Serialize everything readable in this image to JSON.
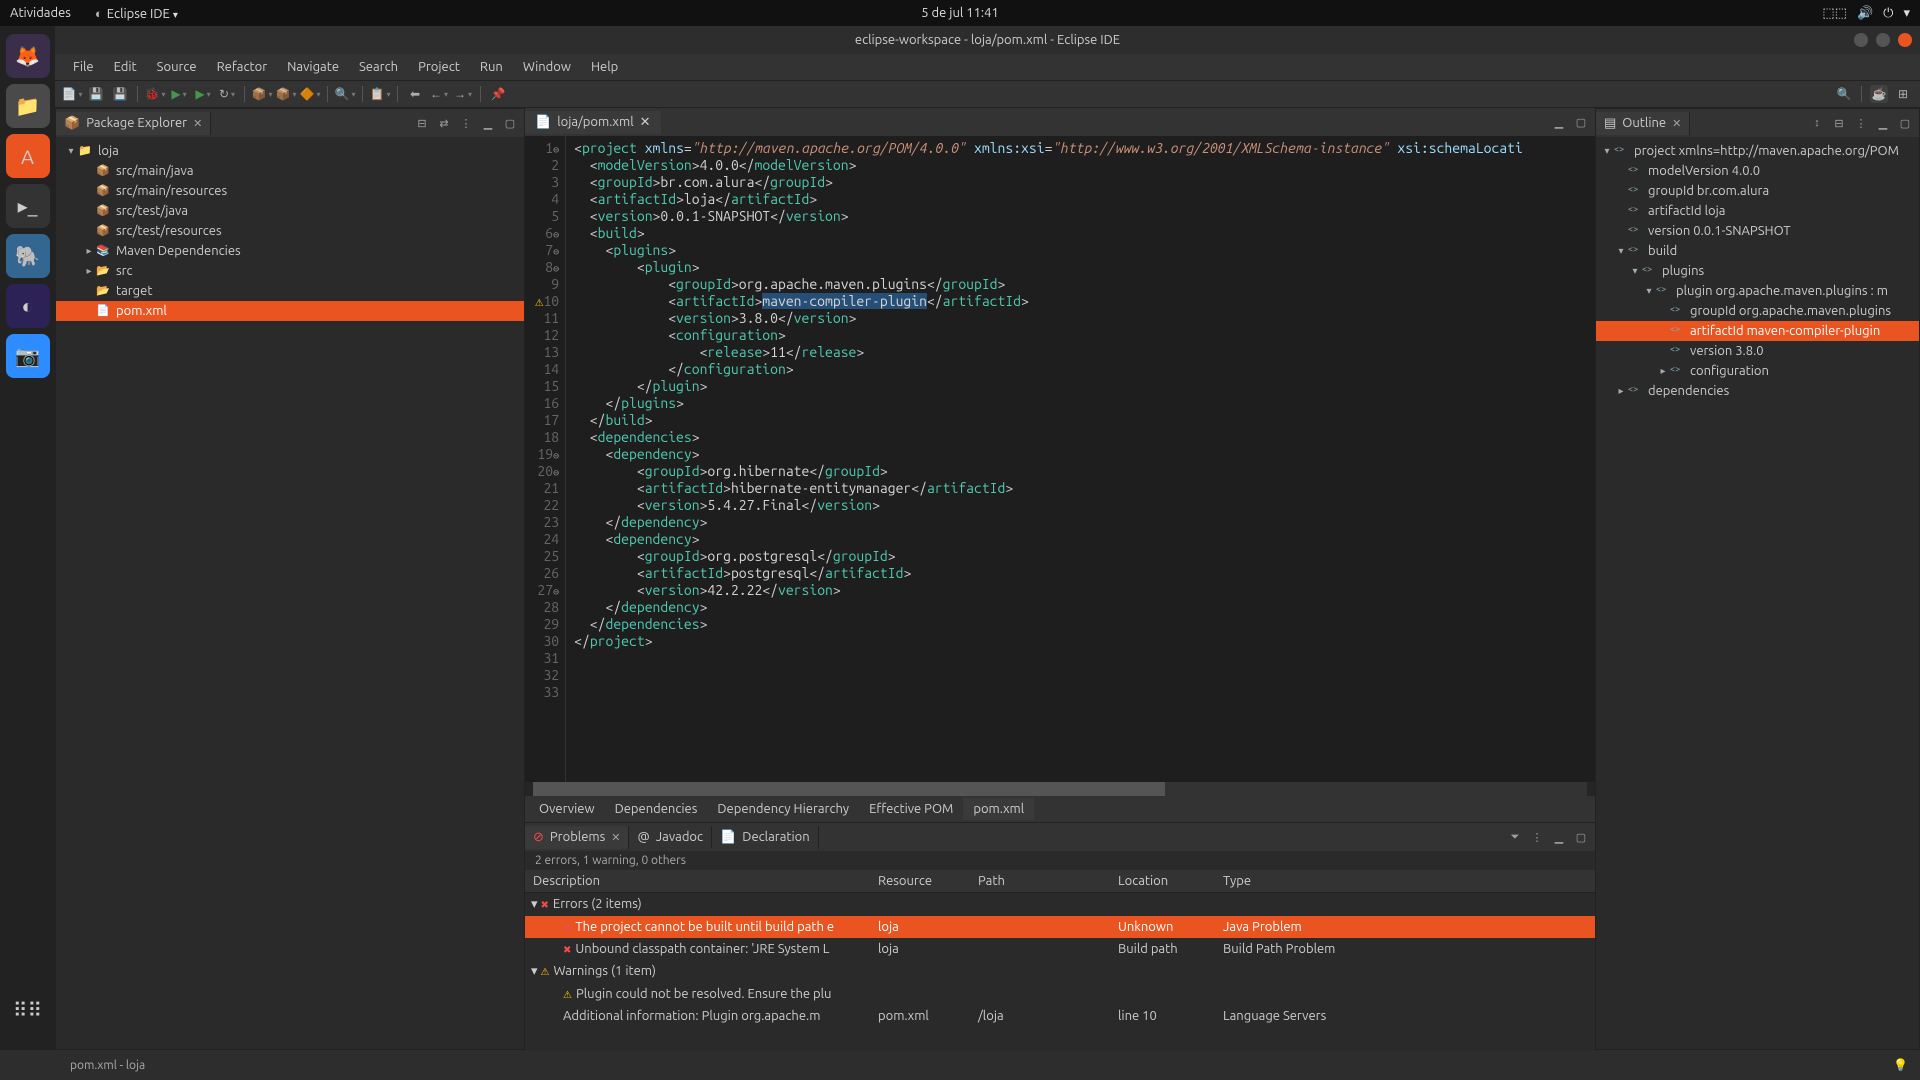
{
  "top_panel": {
    "activities": "Atividades",
    "app_menu": "Eclipse IDE",
    "clock": "5 de jul  11:41"
  },
  "titlebar": "eclipse-workspace - loja/pom.xml - Eclipse IDE",
  "menubar": [
    "File",
    "Edit",
    "Source",
    "Refactor",
    "Navigate",
    "Search",
    "Project",
    "Run",
    "Window",
    "Help"
  ],
  "package_explorer": {
    "title": "Package Explorer",
    "items": [
      {
        "indent": 0,
        "twisty": "▾",
        "icon": "📁",
        "label": "loja"
      },
      {
        "indent": 1,
        "twisty": "",
        "icon": "📦",
        "label": "src/main/java"
      },
      {
        "indent": 1,
        "twisty": "",
        "icon": "📦",
        "label": "src/main/resources"
      },
      {
        "indent": 1,
        "twisty": "",
        "icon": "📦",
        "label": "src/test/java"
      },
      {
        "indent": 1,
        "twisty": "",
        "icon": "📦",
        "label": "src/test/resources"
      },
      {
        "indent": 1,
        "twisty": "▸",
        "icon": "📚",
        "label": "Maven Dependencies"
      },
      {
        "indent": 1,
        "twisty": "▸",
        "icon": "📂",
        "label": "src"
      },
      {
        "indent": 1,
        "twisty": "",
        "icon": "📂",
        "label": "target"
      },
      {
        "indent": 1,
        "twisty": "",
        "icon": "📄",
        "label": "pom.xml",
        "selected": true
      }
    ]
  },
  "editor": {
    "tab": "loja/pom.xml",
    "bottom_tabs": [
      "Overview",
      "Dependencies",
      "Dependency Hierarchy",
      "Effective POM",
      "pom.xml"
    ],
    "bottom_active": 4,
    "lines": [
      1,
      2,
      3,
      4,
      5,
      6,
      7,
      8,
      9,
      10,
      11,
      12,
      13,
      14,
      15,
      16,
      17,
      18,
      19,
      20,
      21,
      22,
      23,
      24,
      25,
      26,
      27,
      28,
      29,
      30,
      31,
      32,
      33
    ],
    "code_values": {
      "xmlns": "\"http://maven.apache.org/POM/4.0.0\"",
      "xmlns_xsi_attr": "xmlns:xsi",
      "xmlns_xsi_val": "\"http://www.w3.org/2001/XMLSchema-instance\"",
      "schema_attr": "xsi:schemaLocati",
      "modelVersion": "4.0.0",
      "groupId": "br.com.alura",
      "artifactId": "loja",
      "version": "0.0.1-SNAPSHOT",
      "plugin_groupId": "org.apache.maven.plugins",
      "plugin_artifactId": "maven-compiler-plugin",
      "plugin_version": "3.8.0",
      "release": "11",
      "dep1_groupId": "org.hibernate",
      "dep1_artifactId": "hibernate-entitymanager",
      "dep1_version": "5.4.27.Final",
      "dep2_groupId": "org.postgresql",
      "dep2_artifactId": "postgresql",
      "dep2_version": "42.2.22"
    }
  },
  "outline": {
    "title": "Outline",
    "items": [
      {
        "indent": 0,
        "twisty": "▾",
        "label": "project xmlns=http://maven.apache.org/POM"
      },
      {
        "indent": 1,
        "twisty": "",
        "label": "modelVersion  4.0.0"
      },
      {
        "indent": 1,
        "twisty": "",
        "label": "groupId  br.com.alura"
      },
      {
        "indent": 1,
        "twisty": "",
        "label": "artifactId  loja"
      },
      {
        "indent": 1,
        "twisty": "",
        "label": "version  0.0.1-SNAPSHOT"
      },
      {
        "indent": 1,
        "twisty": "▾",
        "label": "build"
      },
      {
        "indent": 2,
        "twisty": "▾",
        "label": "plugins"
      },
      {
        "indent": 3,
        "twisty": "▾",
        "label": "plugin  org.apache.maven.plugins : m"
      },
      {
        "indent": 4,
        "twisty": "",
        "label": "groupId  org.apache.maven.plugins"
      },
      {
        "indent": 4,
        "twisty": "",
        "label": "artifactId  maven-compiler-plugin",
        "selected": true
      },
      {
        "indent": 4,
        "twisty": "",
        "label": "version  3.8.0"
      },
      {
        "indent": 4,
        "twisty": "▸",
        "label": "configuration"
      },
      {
        "indent": 1,
        "twisty": "▸",
        "label": "dependencies"
      }
    ]
  },
  "problems": {
    "tabs": [
      "Problems",
      "Javadoc",
      "Declaration"
    ],
    "summary": "2 errors, 1 warning, 0 others",
    "columns": [
      "Description",
      "Resource",
      "Path",
      "Location",
      "Type"
    ],
    "rows": [
      {
        "kind": "group",
        "twisty": "▾",
        "icon": "err",
        "desc": "Errors (2 items)"
      },
      {
        "kind": "item",
        "icon": "err",
        "desc": "The project cannot be built until build path e",
        "res": "loja",
        "path": "",
        "loc": "Unknown",
        "type": "Java Problem",
        "selected": true
      },
      {
        "kind": "item",
        "icon": "err",
        "desc": "Unbound classpath container: 'JRE System L",
        "res": "loja",
        "path": "",
        "loc": "Build path",
        "type": "Build Path Problem"
      },
      {
        "kind": "group",
        "twisty": "▾",
        "icon": "warn",
        "desc": "Warnings (1 item)"
      },
      {
        "kind": "item",
        "icon": "warn",
        "desc": "Plugin could not be resolved. Ensure the plu",
        "res": "",
        "path": "",
        "loc": "",
        "type": ""
      },
      {
        "kind": "item",
        "icon": "",
        "desc": "Additional information: Plugin org.apache.m",
        "res": "pom.xml",
        "path": "/loja",
        "loc": "line 10",
        "type": "Language Servers"
      }
    ]
  },
  "statusbar": "pom.xml - loja"
}
